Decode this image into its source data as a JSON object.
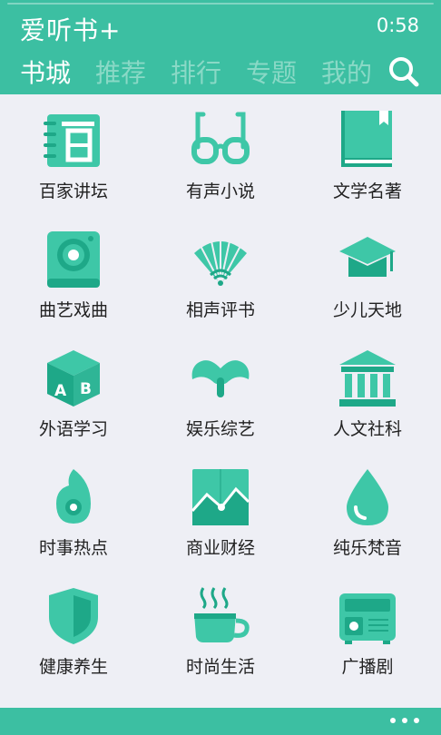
{
  "header": {
    "title": "爱听书+",
    "time": "0:58"
  },
  "tabs": [
    {
      "label": "书城",
      "active": true
    },
    {
      "label": "推荐",
      "active": false
    },
    {
      "label": "排行",
      "active": false
    },
    {
      "label": "专题",
      "active": false
    },
    {
      "label": "我的",
      "active": false
    }
  ],
  "search_icon": "search-icon",
  "categories": [
    {
      "label": "百家讲坛",
      "icon": "notebook-icon"
    },
    {
      "label": "有声小说",
      "icon": "glasses-icon"
    },
    {
      "label": "文学名著",
      "icon": "book-icon"
    },
    {
      "label": "曲艺戏曲",
      "icon": "speaker-icon"
    },
    {
      "label": "相声评书",
      "icon": "fan-icon"
    },
    {
      "label": "少儿天地",
      "icon": "graduation-cap-icon"
    },
    {
      "label": "外语学习",
      "icon": "ab-cube-icon"
    },
    {
      "label": "娱乐综艺",
      "icon": "mustache-icon"
    },
    {
      "label": "人文社科",
      "icon": "museum-icon"
    },
    {
      "label": "时事热点",
      "icon": "flame-icon"
    },
    {
      "label": "商业财经",
      "icon": "chart-icon"
    },
    {
      "label": "纯乐梵音",
      "icon": "drop-icon"
    },
    {
      "label": "健康养生",
      "icon": "shield-icon"
    },
    {
      "label": "时尚生活",
      "icon": "coffee-cup-icon"
    },
    {
      "label": "广播剧",
      "icon": "radio-icon"
    }
  ],
  "colors": {
    "accent": "#3cbfa2",
    "icon": "#3ec7a7",
    "icon_dark": "#1ea888",
    "background": "#eeeff5"
  },
  "more_icon": "more-icon"
}
